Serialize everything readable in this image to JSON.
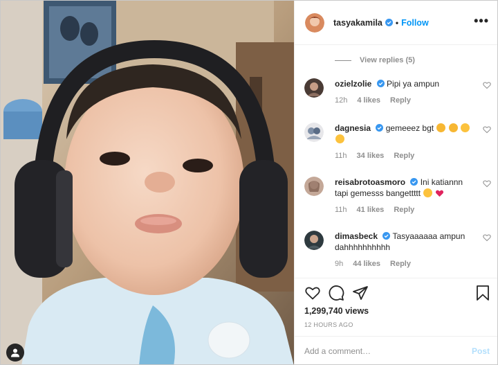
{
  "post": {
    "author": "tasyakamila",
    "follow_label": "Follow",
    "dot": "•",
    "more_label": "•••"
  },
  "comments_section": {
    "view_replies": "View replies (5)",
    "items": [
      {
        "user": "ozielzolie",
        "text": "Pipi ya ampun",
        "time": "12h",
        "likes": "4 likes",
        "reply": "Reply",
        "emojis": []
      },
      {
        "user": "dagnesia",
        "text": "gemeeez bgt",
        "time": "11h",
        "likes": "34 likes",
        "reply": "Reply",
        "emojis": [
          "star-struck-emoji",
          "star-struck-emoji",
          "smiling-emoji",
          "smiling-emoji"
        ]
      },
      {
        "user": "reisabrotoasmoro",
        "text": "Ini katiannn tapi gemesss bangettttt",
        "time": "11h",
        "likes": "41 likes",
        "reply": "Reply",
        "emojis": [
          "grinning-sweat-emoji",
          "heart-emoji"
        ]
      },
      {
        "user": "dimasbeck",
        "text": "Tasyaaaaaa ampun dahhhhhhhhhh",
        "time": "9h",
        "likes": "44 likes",
        "reply": "Reply",
        "emojis": []
      }
    ]
  },
  "stats": {
    "views": "1,299,740 views",
    "posted": "12 HOURS AGO"
  },
  "composer": {
    "placeholder": "Add a comment…",
    "post_label": "Post"
  },
  "colors": {
    "accent": "#0095f6",
    "verified": "#3897f0",
    "muted": "#8e8e8e",
    "post_disabled": "#b2dffc"
  },
  "icons": {
    "header": [
      "verified-badge-icon",
      "more-options-icon"
    ],
    "actions": [
      "like-heart-icon",
      "comment-bubble-icon",
      "share-direct-icon",
      "save-bookmark-icon"
    ],
    "media": [
      "user-tag-icon"
    ]
  }
}
